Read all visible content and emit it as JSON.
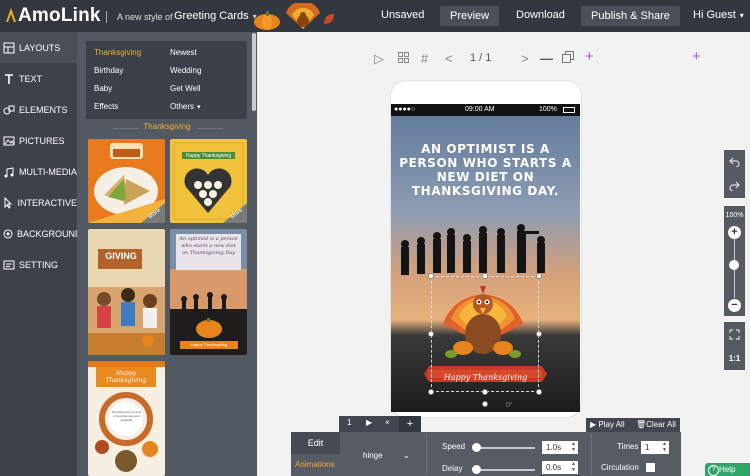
{
  "app": {
    "logo": "AmoLink",
    "tagline": "A new style of",
    "type_selector": "Greeting Cards"
  },
  "topbar": {
    "unsaved": "Unsaved",
    "preview": "Preview",
    "download": "Download",
    "publish": "Publish & Share",
    "user": "Hi Guest"
  },
  "sidebar": {
    "items": [
      {
        "label": "LAYOUTS",
        "icon": "layouts-icon"
      },
      {
        "label": "TEXT",
        "icon": "text-icon"
      },
      {
        "label": "ELEMENTS",
        "icon": "elements-icon"
      },
      {
        "label": "PICTURES",
        "icon": "pictures-icon"
      },
      {
        "label": "MULTI-MEDIA",
        "icon": "multimedia-icon"
      },
      {
        "label": "INTERACTIVE",
        "icon": "interactive-icon"
      },
      {
        "label": "BACKGROUND",
        "icon": "background-icon"
      },
      {
        "label": "SETTING",
        "icon": "setting-icon"
      }
    ]
  },
  "categories": {
    "items": [
      "Thanksgiving",
      "Newest",
      "Birthday",
      "Wedding",
      "Baby",
      "Get Well",
      "Effects",
      "Others"
    ],
    "selected": "Thanksgiving"
  },
  "templates": {
    "section_title": "Thanksgiving",
    "more": "More",
    "thumb2_banner": "Happy Thanksgiving",
    "thumb3_title": "GIVING",
    "thumb4_text": "An optimist is a person who starts a new diet on Thanksgiving Day",
    "thumb4_banner": "Happy Thanksgiving",
    "thumb5_title": "Happy Thanksgiving",
    "thumb5_text": "Thanksgiving is a time of togetherness and gratitude"
  },
  "toolbar": {
    "page": "1 / 1"
  },
  "card": {
    "status_time": "09:00 AM",
    "status_battery": "100%",
    "headline": "AN OPTIMIST IS A PERSON WHO STARTS A NEW DIET ON THANKSGIVING DAY.",
    "banner": "Happy Thanksgiving",
    "rotation": "0°"
  },
  "zoom": {
    "level": "100%",
    "reset": "1:1"
  },
  "animation": {
    "page_tab": "1",
    "play_all": "Play All",
    "clear_all": "Clear All",
    "edit_tab": "Edit",
    "animations_tab": "Animations",
    "effect": "hinge",
    "speed_label": "Speed",
    "speed_value": "1.0s",
    "delay_label": "Delay",
    "delay_value": "0.0s",
    "times_label": "Times",
    "times_value": "1",
    "circulation_label": "Circulation"
  },
  "help": "Help",
  "colors": {
    "accent_orange": "#f0ad2d",
    "add_purple": "#b94fe0",
    "help_green": "#2fa56a",
    "topbar_bg": "#33373f"
  }
}
